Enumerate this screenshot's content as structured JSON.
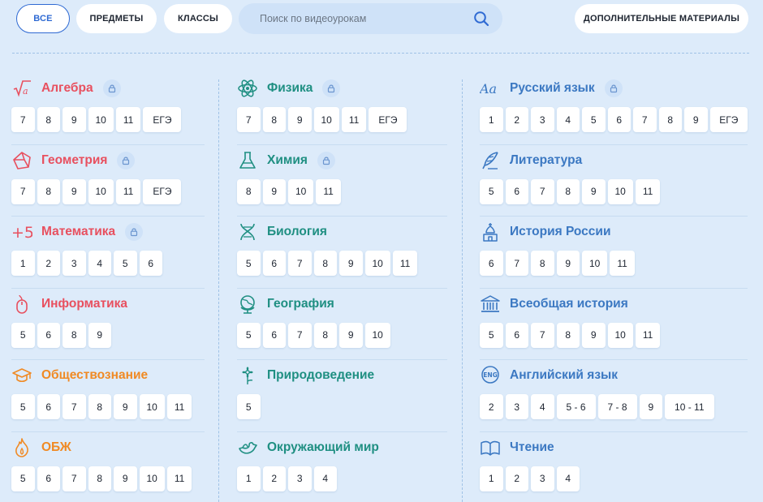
{
  "header": {
    "filters": [
      "ВСЕ",
      "ПРЕДМЕТЫ",
      "КЛАССЫ"
    ],
    "search_placeholder": "Поиск по видеоурокам",
    "extra_button": "ДОПОЛНИТЕЛЬНЫЕ МАТЕРИАЛЫ"
  },
  "colors": {
    "red": "#e8505f",
    "orange": "#f08a24",
    "teal": "#1f8f82",
    "blue": "#3b78c2",
    "active": "#2f6ad3"
  },
  "columns": [
    [
      {
        "name": "Алгебра",
        "icon": "sqrt-icon",
        "color": "red",
        "locked": true,
        "grades": [
          "7",
          "8",
          "9",
          "10",
          "11",
          "ЕГЭ"
        ]
      },
      {
        "name": "Геометрия",
        "icon": "polyhedron-icon",
        "color": "red",
        "locked": true,
        "grades": [
          "7",
          "8",
          "9",
          "10",
          "11",
          "ЕГЭ"
        ]
      },
      {
        "name": "Математика",
        "icon": "plus-five-icon",
        "color": "red",
        "locked": true,
        "grades": [
          "1",
          "2",
          "3",
          "4",
          "5",
          "6"
        ]
      },
      {
        "name": "Информатика",
        "icon": "mouse-icon",
        "color": "red",
        "locked": false,
        "grades": [
          "5",
          "6",
          "8",
          "9"
        ]
      },
      {
        "name": "Обществознание",
        "icon": "graduation-cap-icon",
        "color": "orange",
        "locked": false,
        "grades": [
          "5",
          "6",
          "7",
          "8",
          "9",
          "10",
          "11"
        ]
      },
      {
        "name": "ОБЖ",
        "icon": "fire-icon",
        "color": "orange",
        "locked": false,
        "grades": [
          "5",
          "6",
          "7",
          "8",
          "9",
          "10",
          "11"
        ]
      }
    ],
    [
      {
        "name": "Физика",
        "icon": "atom-icon",
        "color": "teal",
        "locked": true,
        "grades": [
          "7",
          "8",
          "9",
          "10",
          "11",
          "ЕГЭ"
        ]
      },
      {
        "name": "Химия",
        "icon": "flask-icon",
        "color": "teal",
        "locked": true,
        "grades": [
          "8",
          "9",
          "10",
          "11"
        ]
      },
      {
        "name": "Биология",
        "icon": "dna-icon",
        "color": "teal",
        "locked": false,
        "grades": [
          "5",
          "6",
          "7",
          "8",
          "9",
          "10",
          "11"
        ]
      },
      {
        "name": "География",
        "icon": "globe-icon",
        "color": "teal",
        "locked": false,
        "grades": [
          "5",
          "6",
          "7",
          "8",
          "9",
          "10"
        ]
      },
      {
        "name": "Природоведение",
        "icon": "flower-icon",
        "color": "teal",
        "locked": false,
        "grades": [
          "5"
        ]
      },
      {
        "name": "Окружающий мир",
        "icon": "bird-icon",
        "color": "teal",
        "locked": false,
        "grades": [
          "1",
          "2",
          "3",
          "4"
        ]
      }
    ],
    [
      {
        "name": "Русский язык",
        "icon": "letters-icon",
        "color": "blue",
        "locked": true,
        "grades": [
          "1",
          "2",
          "3",
          "4",
          "5",
          "6",
          "7",
          "8",
          "9",
          "ЕГЭ"
        ]
      },
      {
        "name": "Литература",
        "icon": "quill-icon",
        "color": "blue",
        "locked": false,
        "grades": [
          "5",
          "6",
          "7",
          "8",
          "9",
          "10",
          "11"
        ]
      },
      {
        "name": "История России",
        "icon": "church-icon",
        "color": "blue",
        "locked": false,
        "grades": [
          "6",
          "7",
          "8",
          "9",
          "10",
          "11"
        ]
      },
      {
        "name": "Всеобщая история",
        "icon": "temple-icon",
        "color": "blue",
        "locked": false,
        "grades": [
          "5",
          "6",
          "7",
          "8",
          "9",
          "10",
          "11"
        ]
      },
      {
        "name": "Английский язык",
        "icon": "eng-icon",
        "color": "blue",
        "locked": false,
        "grades": [
          "2",
          "3",
          "4",
          "5 - 6",
          "7 - 8",
          "9",
          "10 - 11"
        ]
      },
      {
        "name": "Чтение",
        "icon": "book-icon",
        "color": "blue",
        "locked": false,
        "grades": [
          "1",
          "2",
          "3",
          "4"
        ]
      }
    ]
  ]
}
